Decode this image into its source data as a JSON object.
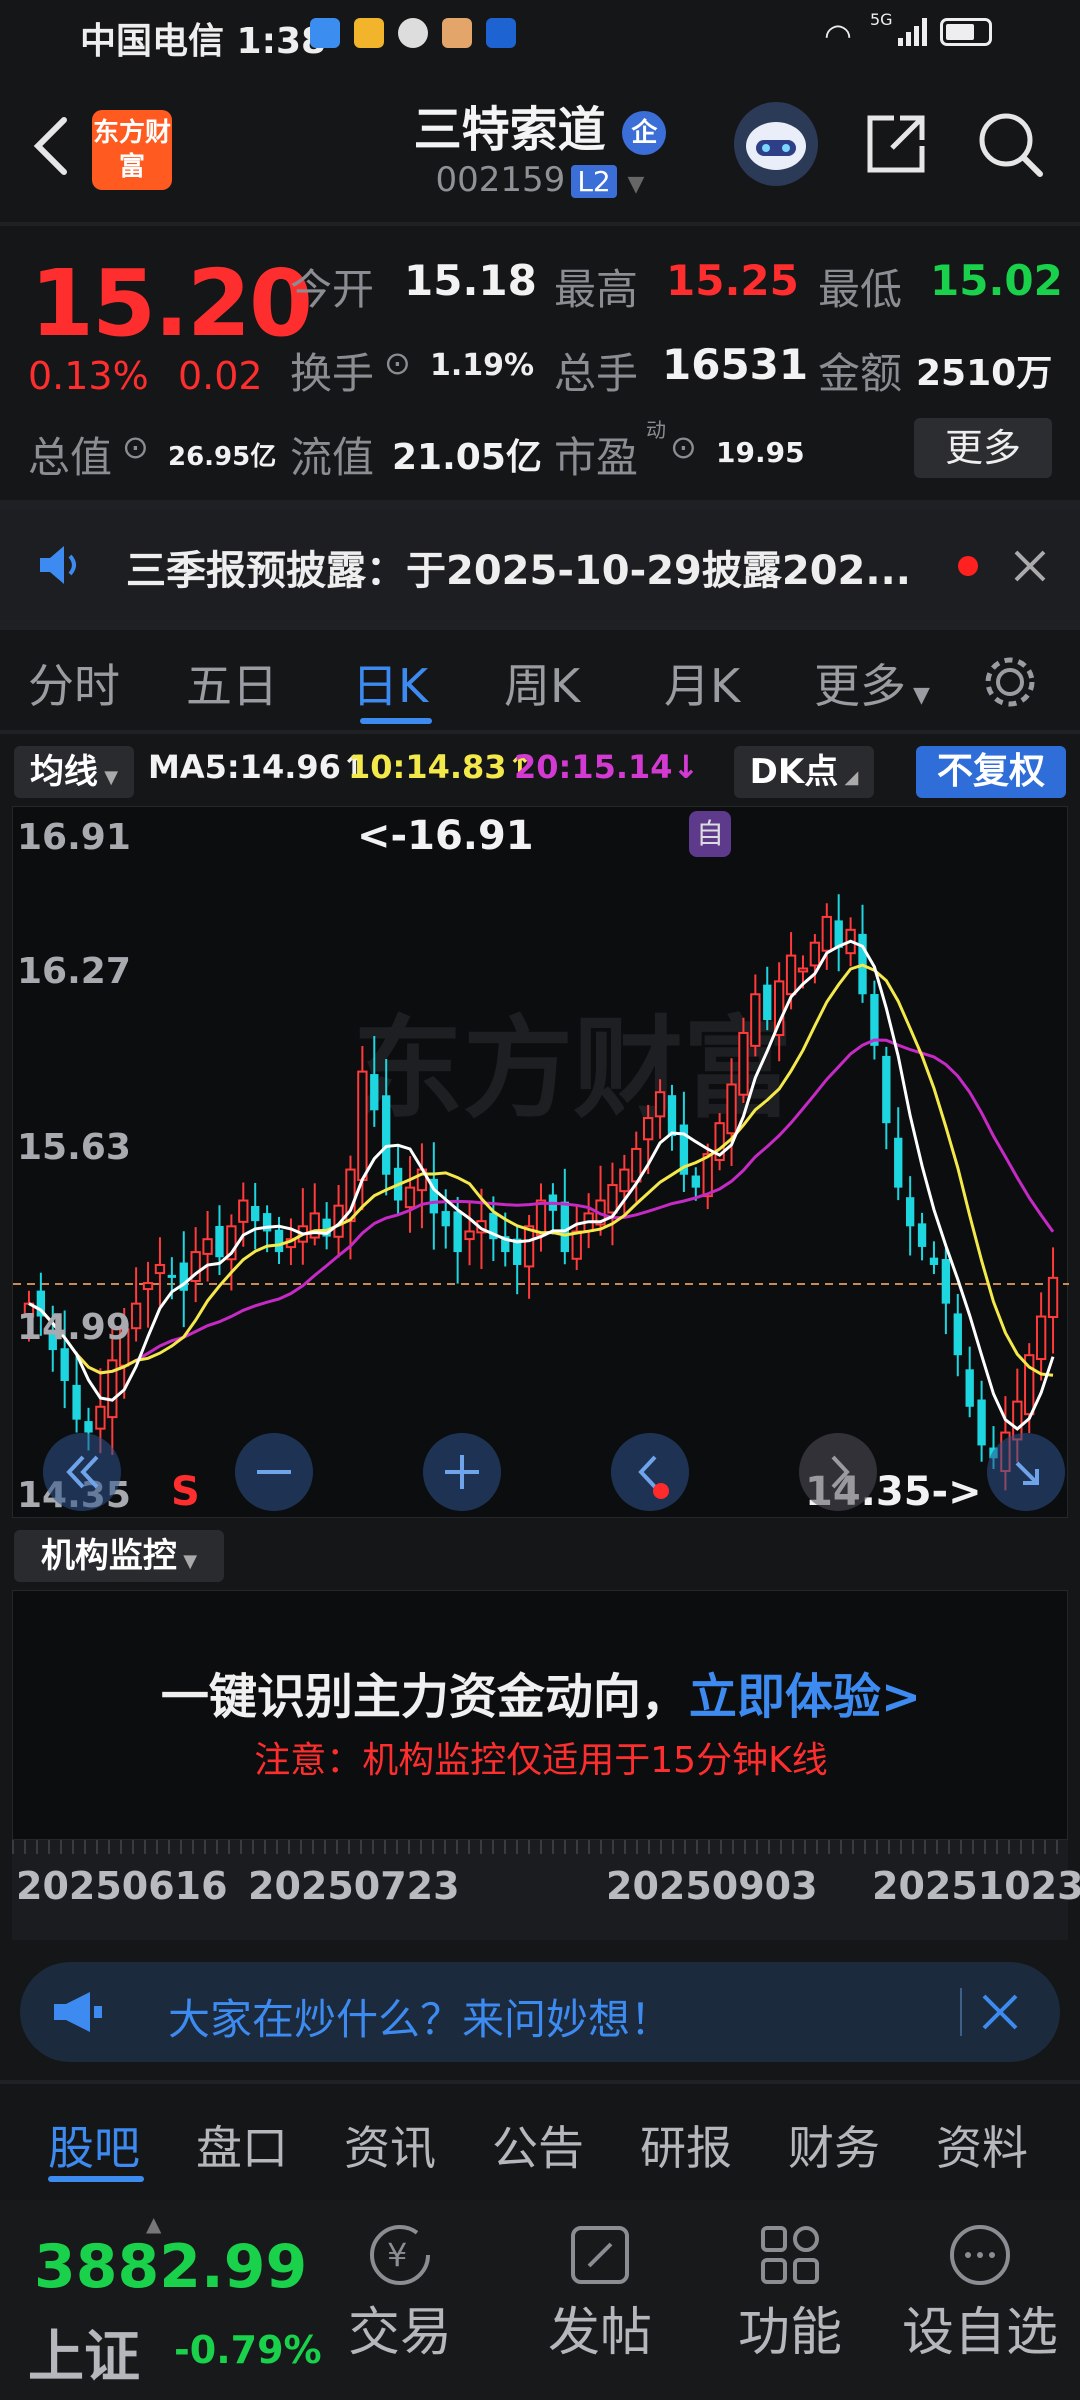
{
  "status": {
    "time_label": "中国电信 1:38",
    "network": "5G",
    "battery": "▮▮▮"
  },
  "header": {
    "title": "三特索道",
    "enterprise_badge": "企",
    "code": "002159",
    "level": "L2",
    "logo_text": "东方财富"
  },
  "quote": {
    "price": "15.20",
    "change_pct": "0.13%",
    "change": "0.02",
    "open_label": "今开",
    "open": "15.18",
    "high_label": "最高",
    "high": "15.25",
    "low_label": "最低",
    "low": "15.02",
    "turnover_label": "换手",
    "turnover": "1.19%",
    "volume_label": "总手",
    "volume": "16531",
    "amount_label": "金额",
    "amount": "2510万",
    "mcap_label": "总值",
    "mcap": "26.95亿",
    "float_label": "流值",
    "float": "21.05亿",
    "pe_label": "市盈",
    "pe_sup": "动",
    "pe": "19.95",
    "more_label": "更多"
  },
  "notice": {
    "text": "三季报预披露：于2025-10-29披露202..."
  },
  "tabs": [
    "分时",
    "五日",
    "日K",
    "周K",
    "月K",
    "更多"
  ],
  "toolbar": {
    "ma_select": "均线",
    "ma5": "MA5:14.96↑",
    "ma10": "10:14.83↑",
    "ma20": "20:15.14↓",
    "dk_label": "DK点",
    "fq_label": "不复权"
  },
  "chart": {
    "y_labels": [
      "16.91",
      "16.27",
      "15.63",
      "14.99",
      "14.35"
    ],
    "max_annot": "<-16.91",
    "min_annot": "14.35->",
    "self_tag": "自",
    "sell_tag": "S",
    "colors": {
      "up": "#ff3b3b",
      "down": "#1ed6e0",
      "ma5": "#ffffff",
      "ma10": "#f4e94b",
      "ma20": "#c52ac5"
    }
  },
  "chart_data": {
    "type": "candlestick",
    "x_start": "20250616",
    "x_end": "20251023",
    "ylim": [
      14.35,
      16.91
    ],
    "series": [
      {
        "name": "MA5",
        "current": 14.96
      },
      {
        "name": "MA10",
        "current": 14.83
      },
      {
        "name": "MA20",
        "current": 15.14
      }
    ],
    "closes": [
      15.1,
      15.05,
      14.92,
      14.8,
      14.65,
      14.6,
      14.7,
      14.88,
      15.0,
      15.1,
      15.18,
      15.25,
      15.2,
      15.15,
      15.3,
      15.35,
      15.28,
      15.4,
      15.5,
      15.42,
      15.38,
      15.3,
      15.35,
      15.4,
      15.45,
      15.36,
      15.48,
      15.62,
      16.0,
      15.85,
      15.6,
      15.5,
      15.55,
      15.62,
      15.45,
      15.4,
      15.3,
      15.38,
      15.42,
      15.35,
      15.3,
      15.25,
      15.4,
      15.5,
      15.46,
      15.3,
      15.38,
      15.45,
      15.5,
      15.56,
      15.62,
      15.7,
      15.82,
      15.92,
      15.75,
      15.6,
      15.55,
      15.68,
      15.8,
      15.95,
      16.15,
      16.3,
      16.2,
      16.35,
      16.45,
      16.4,
      16.5,
      16.6,
      16.48,
      16.55,
      16.3,
      16.1,
      15.8,
      15.55,
      15.4,
      15.32,
      15.25,
      15.1,
      14.9,
      14.7,
      14.55,
      14.5,
      14.6,
      14.72,
      14.9,
      15.05,
      15.2
    ],
    "dates": [
      "20250616",
      "20250723",
      "20250903",
      "20251023"
    ]
  },
  "inst": {
    "select_label": "机构监控",
    "headline": "一键识别主力资金动向，",
    "cta": "立即体验>",
    "note": "注意：机构监控仅适用于15分钟K线"
  },
  "ask": {
    "text": "大家在炒什么？来问妙想！"
  },
  "bottom_tabs": [
    "股吧",
    "盘口",
    "资讯",
    "公告",
    "研报",
    "财务",
    "资料"
  ],
  "index": {
    "value": "3882.99",
    "name": "上证",
    "change": "-0.79%"
  },
  "nav": [
    {
      "label": "交易",
      "icon": "yen-icon"
    },
    {
      "label": "发帖",
      "icon": "edit-icon"
    },
    {
      "label": "功能",
      "icon": "grid-icon"
    },
    {
      "label": "设自选",
      "icon": "more-icon"
    }
  ]
}
